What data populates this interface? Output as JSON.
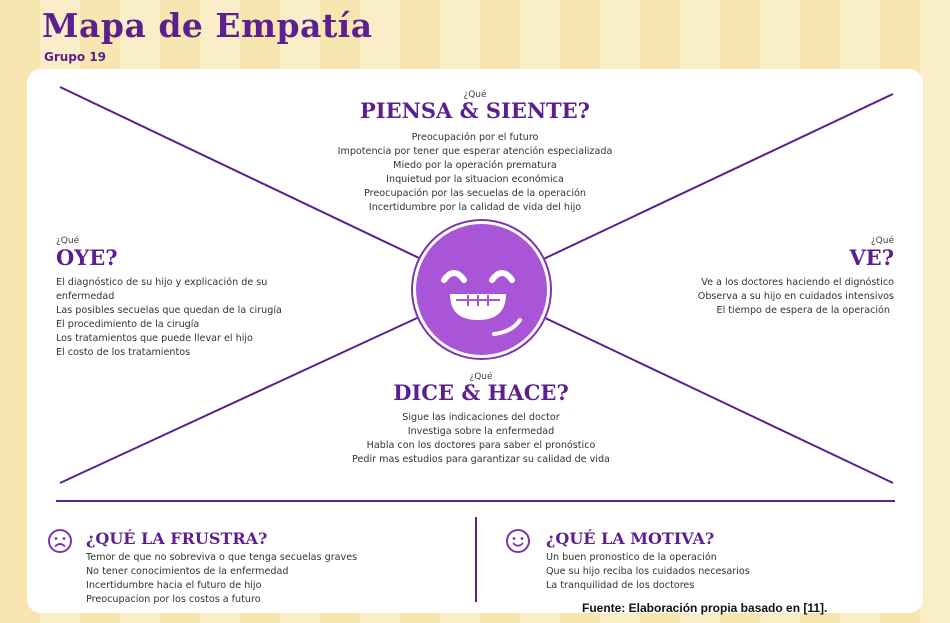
{
  "title": "Mapa de Empatía",
  "subtitle": "Grupo 19",
  "piensa": {
    "question": "¿Qué",
    "heading": "PIENSA & SIENTE?",
    "items": [
      "Preocupación por el futuro",
      "Impotencia por tener que esperar atención especializada",
      "Miedo por la operación prematura",
      "Inquietud por la situacion económica",
      "Preocupación por las secuelas de la operación",
      "Incertidumbre por la calidad de vida del hijo"
    ]
  },
  "oye": {
    "question": "¿Qué",
    "heading": "OYE?",
    "items": [
      "El diagnóstico de su hijo y explicación de su",
      "enfermedad",
      "Las posibles secuelas que quedan de la cirugía",
      "El procedimiento de la cirugía",
      "Los tratamientos que puede llevar el hijo",
      "El costo de los tratamientos"
    ]
  },
  "ve": {
    "question": "¿Qué",
    "heading": "VE?",
    "items": [
      "Ve a los doctores haciendo el dignóstico",
      "Observa a su hijo en cuidados intensivos",
      "El tiempo de espera de la operación"
    ]
  },
  "dice": {
    "question": "¿Qué",
    "heading": "DICE & HACE?",
    "items": [
      "Sigue las indicaciones del doctor",
      "Investiga sobre la enfermedad",
      "Habla con los doctores para saber el  pronóstico",
      "Pedir mas estudios para garantizar su calidad de vida"
    ]
  },
  "frustra": {
    "heading": "¿QUÉ LA FRUSTRA?",
    "icon": "sad-face-icon",
    "items": [
      "Temor de que no sobreviva o que tenga secuelas graves",
      "No tener conocimientos de la enfermedad",
      "Incertidumbre hacia el futuro de hijo",
      "Preocupacion por los costos a futuro"
    ]
  },
  "motiva": {
    "heading": "¿QUÉ LA MOTIVA?",
    "icon": "happy-face-icon",
    "items": [
      "Un buen pronostico de la operación",
      "Que su hijo reciba los cuidados necesarios",
      "La tranquilidad de los doctores"
    ]
  },
  "source": "Fuente: Elaboración propia basado en [11].",
  "colors": {
    "purple": "#5c1f8e",
    "face": "#a855d8",
    "background": "#f7e7b6"
  }
}
